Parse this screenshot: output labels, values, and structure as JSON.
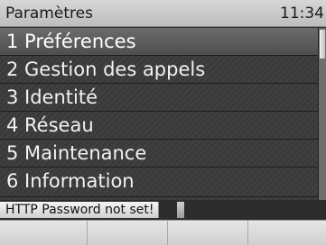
{
  "header": {
    "title": "Paramètres",
    "time": "11:34"
  },
  "menu": {
    "items": [
      {
        "label": "1 Préférences",
        "selected": true
      },
      {
        "label": "2 Gestion des appels",
        "selected": false
      },
      {
        "label": "3 Identité",
        "selected": false
      },
      {
        "label": "4 Réseau",
        "selected": false
      },
      {
        "label": "5 Maintenance",
        "selected": false
      },
      {
        "label": "6 Information",
        "selected": false
      }
    ]
  },
  "status": {
    "message": "HTTP Password not set!"
  },
  "softkeys": {
    "labels": [
      "",
      "",
      "",
      ""
    ]
  },
  "colors": {
    "menu_background": "#3a3a3a",
    "selected_row": "#5e5e5e",
    "header_background": "#c9c9c9",
    "menu_text": "#f2f2f2",
    "status_background": "#e2e2e2"
  },
  "icons": {
    "scrollbar_thumb": "scrollbar-thumb"
  }
}
